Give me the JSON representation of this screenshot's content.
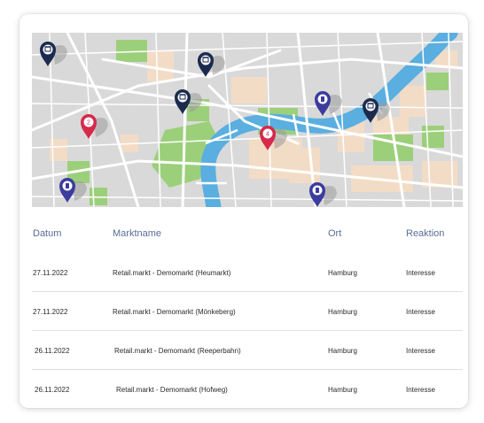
{
  "table": {
    "headers": [
      "Datum",
      "Marktname",
      "Ort",
      "Reaktion"
    ],
    "rows": [
      {
        "date": "27.11.2022",
        "market": "Retail.markt - Demomarkt (Heumarkt)",
        "city": "Hamburg",
        "reaction": "Interesse"
      },
      {
        "date": "27.11.2022",
        "market": "Retail.markt - Demomarkt (Mönkeberg)",
        "city": "Hamburg",
        "reaction": "Interesse"
      },
      {
        "date": "26.11.2022",
        "market": "Retail.markt - Demomarkt (Reeperbahn)",
        "city": "Hamburg",
        "reaction": "Interesse"
      },
      {
        "date": "26.11.2022",
        "market": "Retail.markt - Demomarkt (Hofweg)",
        "city": "Hamburg",
        "reaction": "Interesse"
      }
    ]
  },
  "map": {
    "colors": {
      "water": "#5aaee0",
      "park": "#9ccf7a",
      "block": "#f3dcc6",
      "road": "#ffffff",
      "base": "#d9d9d9"
    },
    "markers": [
      {
        "type": "store",
        "color": "#1b2a4e"
      },
      {
        "type": "store",
        "color": "#1b2a4e"
      },
      {
        "type": "store",
        "color": "#1b2a4e"
      },
      {
        "type": "count",
        "label": "2",
        "color": "#d6294b"
      },
      {
        "type": "fuel",
        "color": "#3c3c9e"
      },
      {
        "type": "store",
        "color": "#1b2a4e"
      },
      {
        "type": "count",
        "label": "4",
        "color": "#d6294b"
      },
      {
        "type": "fuel",
        "color": "#3c3c9e"
      },
      {
        "type": "fuel",
        "color": "#3c3c9e"
      }
    ]
  }
}
